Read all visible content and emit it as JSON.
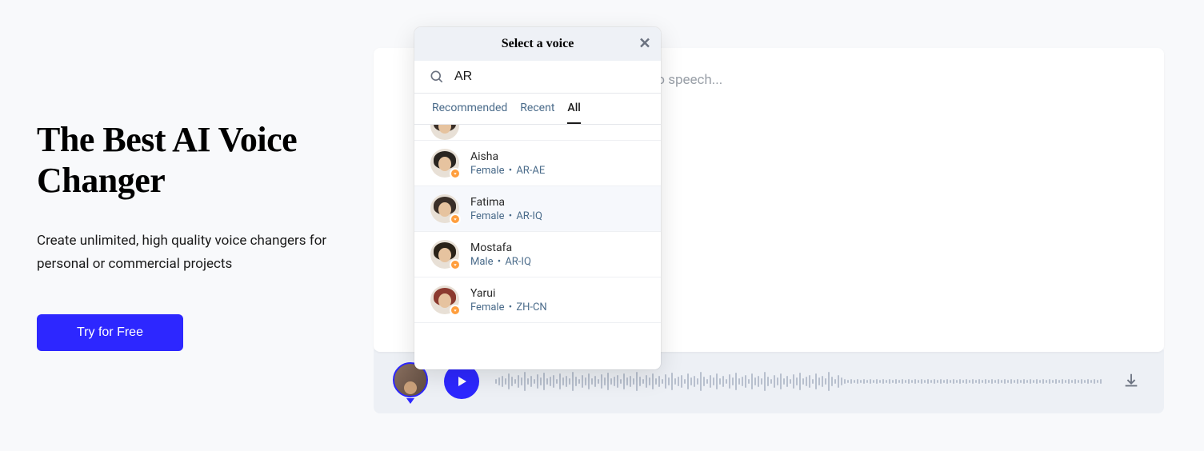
{
  "hero": {
    "heading": "The Best AI Voice Changer",
    "subheading": "Create unlimited, high quality voice changers for personal or commercial projects",
    "cta": "Try for Free"
  },
  "editor": {
    "placeholder_visible_fragment": "ert it to speech..."
  },
  "popover": {
    "title": "Select a voice",
    "search_value": "AR",
    "tabs": [
      {
        "label": "Recommended",
        "active": false
      },
      {
        "label": "Recent",
        "active": false
      },
      {
        "label": "All",
        "active": true
      }
    ],
    "voices": [
      {
        "name": "",
        "gender": "",
        "locale": "",
        "partial": true
      },
      {
        "name": "Aisha",
        "gender": "Female",
        "locale": "AR-AE"
      },
      {
        "name": "Fatima",
        "gender": "Female",
        "locale": "AR-IQ"
      },
      {
        "name": "Mostafa",
        "gender": "Male",
        "locale": "AR-IQ"
      },
      {
        "name": "Yarui",
        "gender": "Female",
        "locale": "ZH-CN"
      }
    ]
  }
}
